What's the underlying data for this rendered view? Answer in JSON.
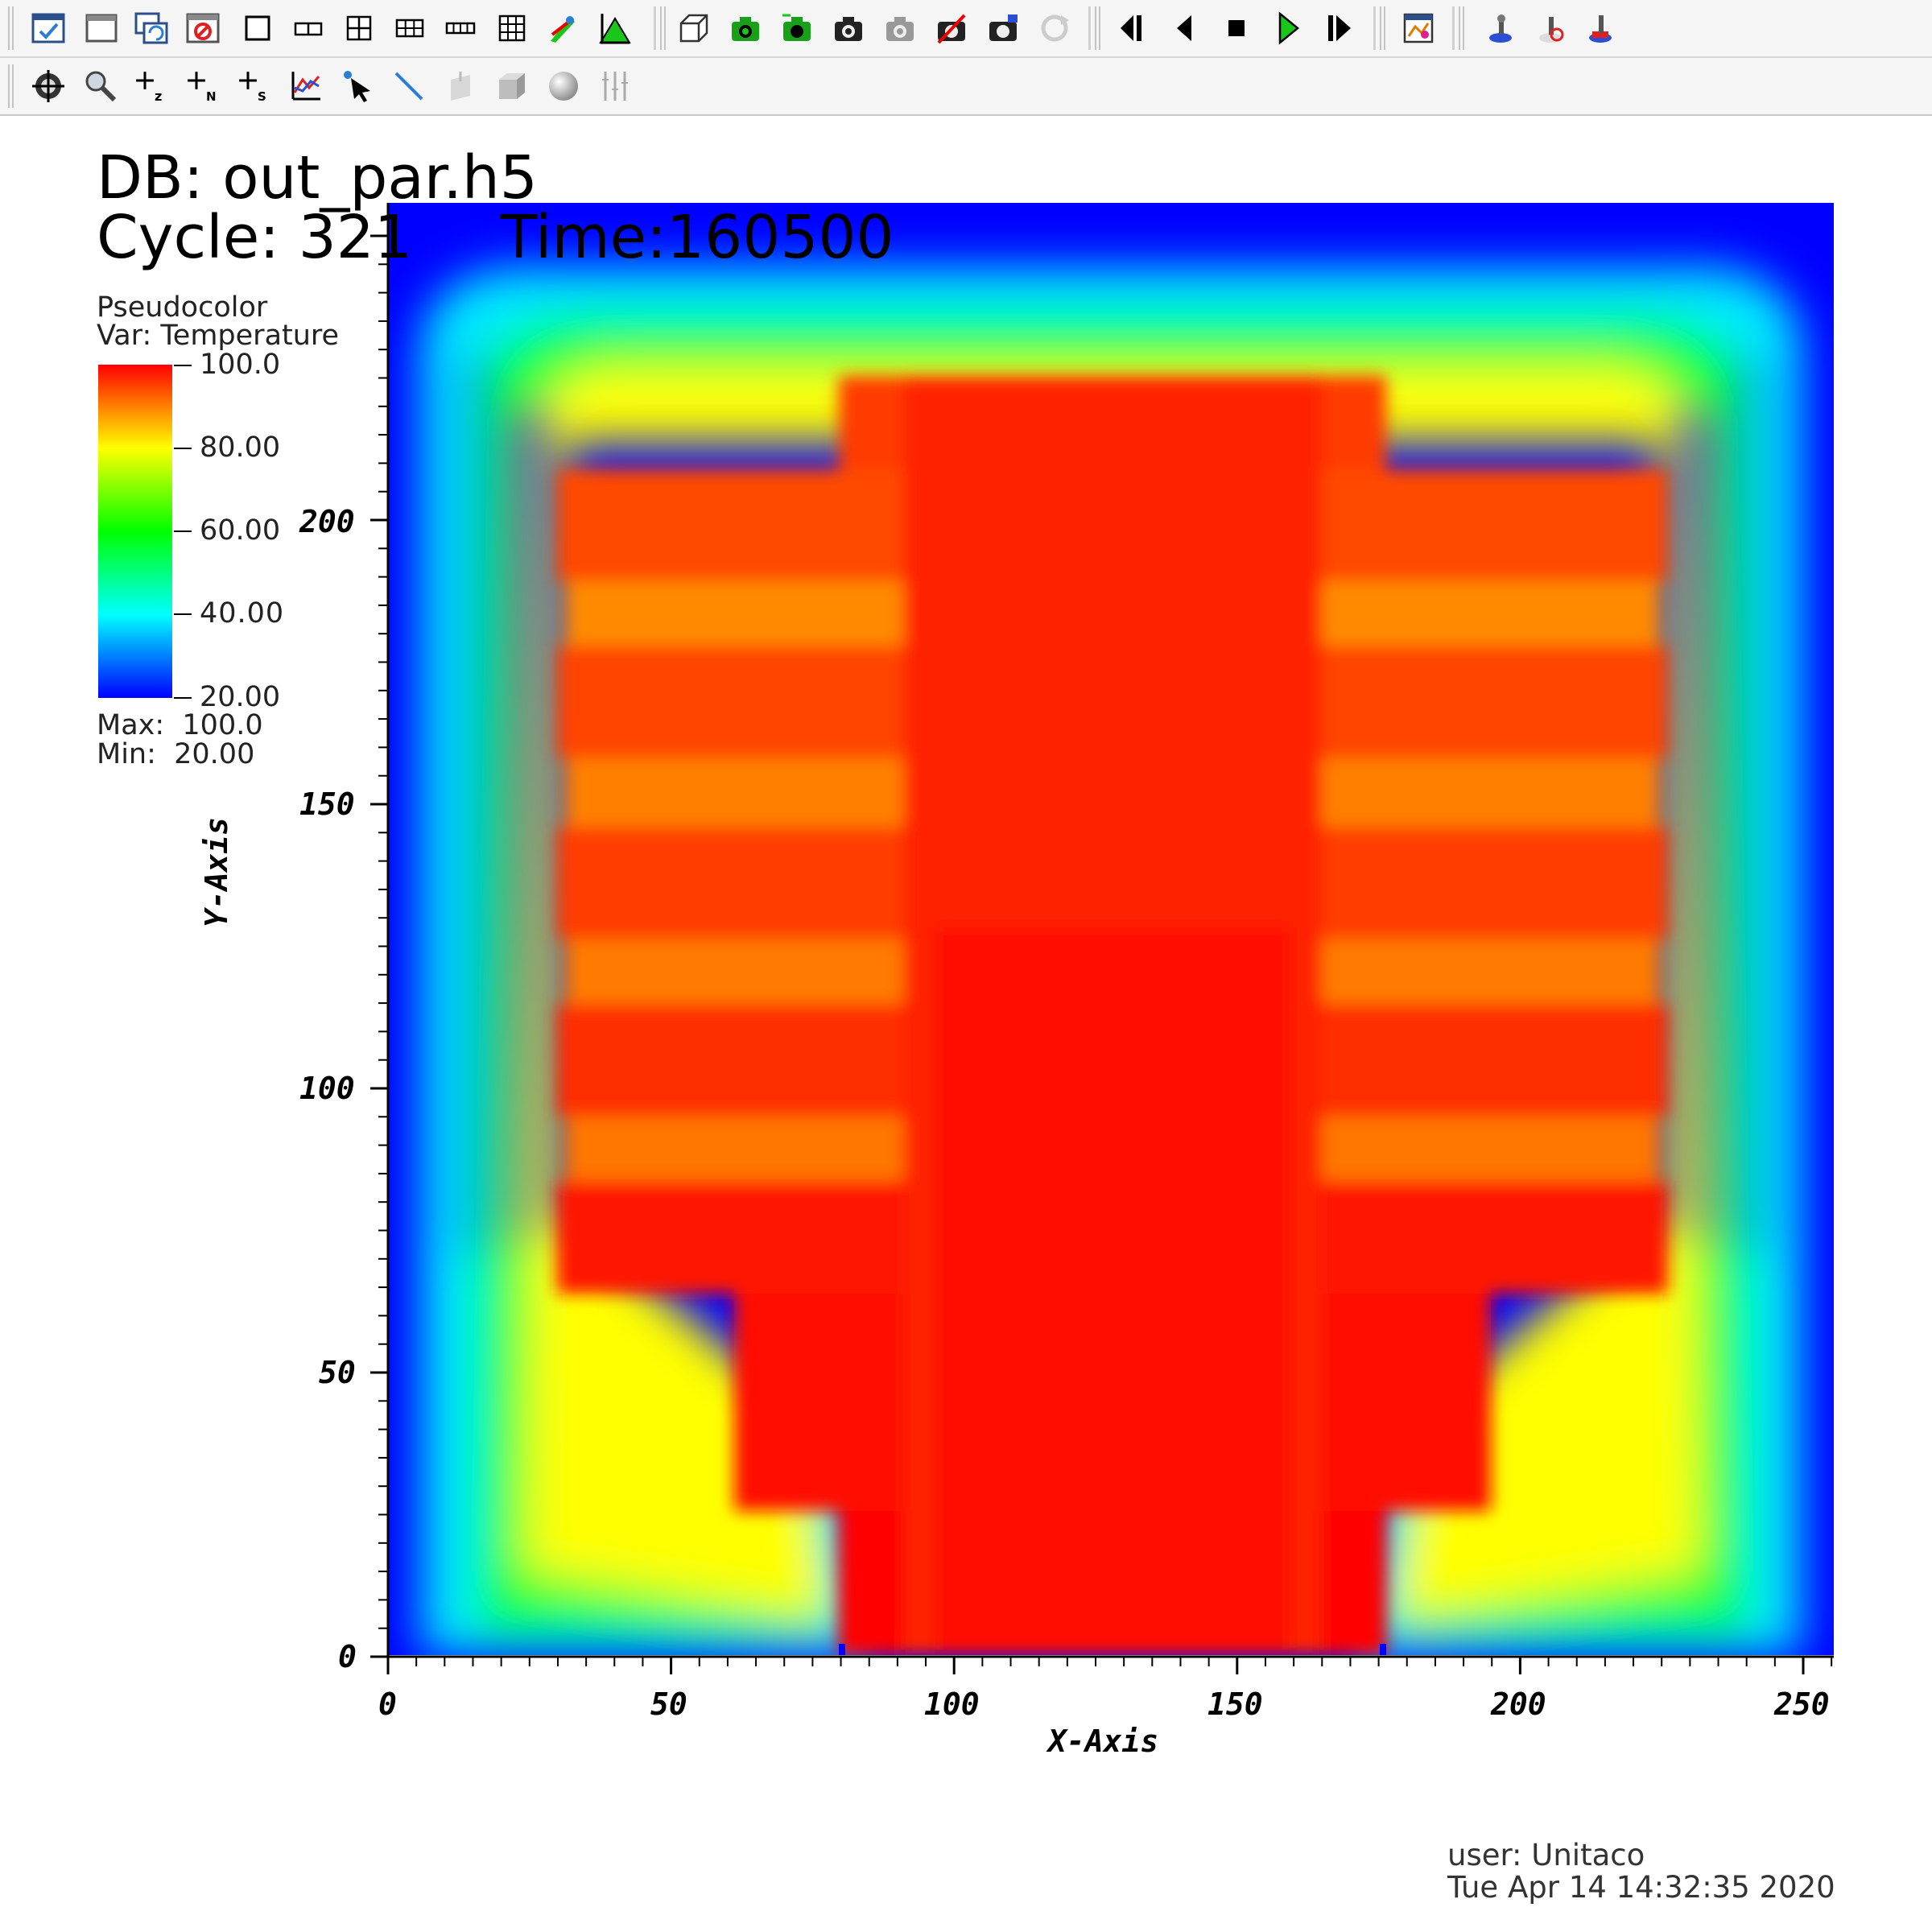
{
  "toolbar_row1": {
    "icons": [
      "active-window-icon",
      "new-window-icon",
      "clone-window-icon",
      "delete-window-icon",
      "layout-1x1-icon",
      "layout-1x2-icon",
      "layout-2x2-icon",
      "layout-2x3-icon",
      "layout-3x1-icon",
      "layout-3x3-icon",
      "lock-view-icon",
      "lock-time-icon",
      "spin-mode-icon",
      "save-view-icon",
      "swap-views-icon",
      "camera-icon",
      "camera-icon-2",
      "undo-view-icon",
      "redo-view-icon",
      "reset-view-icon",
      "previous-frame-icon",
      "reverse-play-icon",
      "stop-icon",
      "play-icon",
      "next-frame-icon",
      "animation-settings-icon",
      "pick-point-icon",
      "pick-node-icon",
      "pick-zone-icon"
    ]
  },
  "toolbar_row2": {
    "icons": [
      "navigate-icon",
      "zoom-icon",
      "pick-z-icon",
      "pick-n-icon",
      "pick-s-icon",
      "lineout-icon",
      "pick-arrow-icon",
      "line-tool-icon",
      "plane-tool-icon",
      "box-tool-icon",
      "sphere-tool-icon",
      "axis-array-icon"
    ]
  },
  "plot": {
    "db_label": "DB: out_par.h5",
    "cycle_label": "Cycle: 321",
    "time_label": "Time:160500"
  },
  "legend": {
    "plot_type": "Pseudocolor",
    "var_label": "Var: Temperature",
    "tick_labels": [
      "100.0",
      "80.00",
      "60.00",
      "40.00",
      "20.00"
    ],
    "max_label": "Max:  100.0",
    "min_label": "Min:  20.00",
    "colors": [
      "#0000ff",
      "#00ffff",
      "#00ff00",
      "#ffff00",
      "#ff0000"
    ]
  },
  "axes": {
    "xlabel": "X-Axis",
    "ylabel": "Y-Axis",
    "x_ticks": [
      "0",
      "50",
      "100",
      "150",
      "200",
      "250"
    ],
    "y_ticks": [
      "0",
      "50",
      "100",
      "150",
      "200"
    ]
  },
  "footer": {
    "user": "user: Unitaco",
    "date": "Tue Apr 14 14:32:35 2020"
  }
}
